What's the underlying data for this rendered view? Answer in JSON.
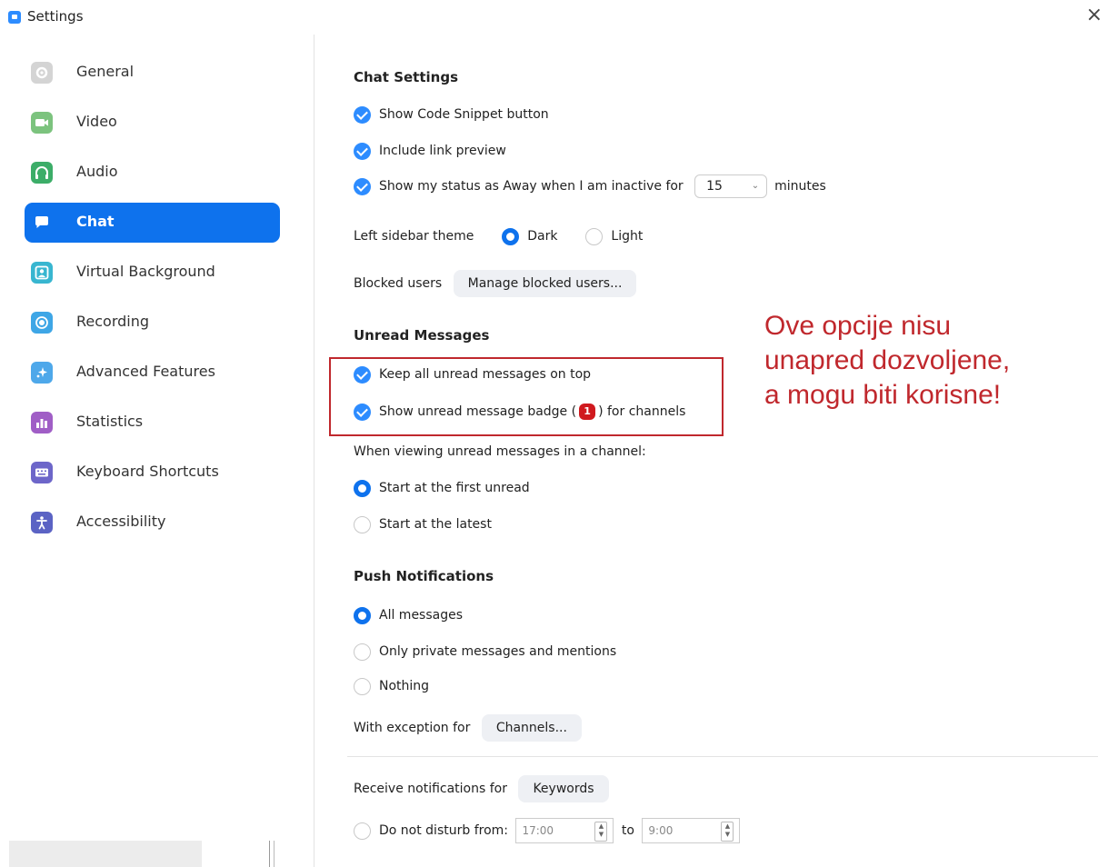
{
  "window": {
    "title": "Settings",
    "close_glyph": "×"
  },
  "sidebar": {
    "items": [
      {
        "label": "General",
        "icon": "gear-icon",
        "color": "#cfcfcf",
        "active": false
      },
      {
        "label": "Video",
        "icon": "video-camera-icon",
        "color": "#7cc37e",
        "active": false
      },
      {
        "label": "Audio",
        "icon": "headphones-icon",
        "color": "#3cad68",
        "active": false
      },
      {
        "label": "Chat",
        "icon": "chat-bubble-icon",
        "color": "#0e72ed",
        "active": true
      },
      {
        "label": "Virtual Background",
        "icon": "person-background-icon",
        "color": "#38b6d0",
        "active": false
      },
      {
        "label": "Recording",
        "icon": "record-icon",
        "color": "#3ea6e6",
        "active": false
      },
      {
        "label": "Advanced Features",
        "icon": "sparkle-icon",
        "color": "#4ea8ea",
        "active": false
      },
      {
        "label": "Statistics",
        "icon": "bar-chart-icon",
        "color": "#a05ec6",
        "active": false
      },
      {
        "label": "Keyboard Shortcuts",
        "icon": "keyboard-icon",
        "color": "#6d66c9",
        "active": false
      },
      {
        "label": "Accessibility",
        "icon": "accessibility-icon",
        "color": "#5b63c4",
        "active": false
      }
    ]
  },
  "chat_settings": {
    "heading": "Chat Settings",
    "show_code_snippet": {
      "label": "Show Code Snippet button",
      "checked": true
    },
    "include_link_preview": {
      "label": "Include link preview",
      "checked": true
    },
    "away_status": {
      "label": "Show my status as Away when I am inactive for",
      "checked": true,
      "value": "15",
      "suffix": "minutes"
    },
    "theme": {
      "label": "Left sidebar theme",
      "options": [
        "Dark",
        "Light"
      ],
      "selected": "Dark"
    },
    "blocked": {
      "label": "Blocked users",
      "button": "Manage blocked users..."
    }
  },
  "unread": {
    "heading": "Unread Messages",
    "keep_on_top": {
      "label": "Keep all unread messages on top",
      "checked": true
    },
    "badge": {
      "label_before": "Show unread message badge (",
      "badge_value": "1",
      "label_after": ") for channels",
      "checked": true
    },
    "viewing_label": "When viewing unread messages in a channel:",
    "options": [
      "Start at the first unread",
      "Start at the latest"
    ],
    "selected": "Start at the first unread"
  },
  "annotation": {
    "lines": [
      "Ove opcije nisu",
      "unapred dozvoljene,",
      "a mogu biti korisne!"
    ],
    "color": "#c0282d"
  },
  "push": {
    "heading": "Push Notifications",
    "options": [
      "All messages",
      "Only private messages and mentions",
      "Nothing"
    ],
    "selected": "All messages",
    "exception_label": "With exception for",
    "exception_button": "Channels..."
  },
  "receive": {
    "label": "Receive notifications for",
    "button": "Keywords"
  },
  "dnd": {
    "label": "Do not disturb from:",
    "checked": false,
    "from": "17:00",
    "to_label": "to",
    "to": "9:00"
  },
  "colors": {
    "accent": "#0e72ed",
    "checkbox": "#2d8cff",
    "badge": "#d0191e"
  }
}
